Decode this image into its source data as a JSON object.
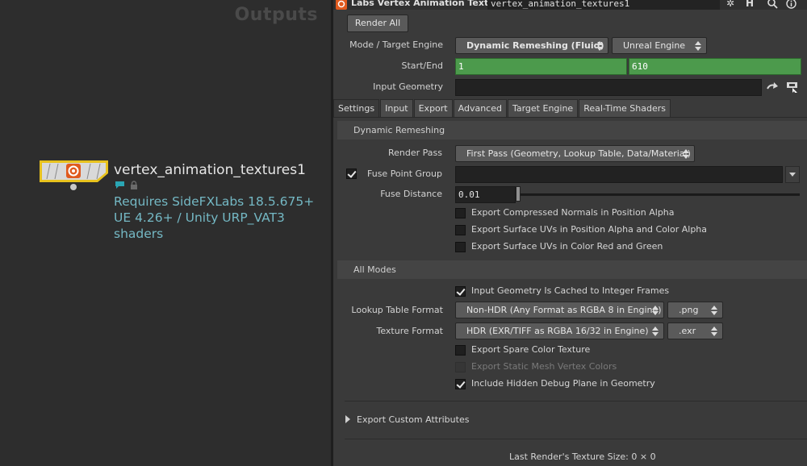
{
  "network": {
    "context_label": "Outputs",
    "node": {
      "name": "vertex_animation_textures1",
      "comment": "Requires SideFXLabs 18.5.675+ UE 4.26+ / Unity URP_VAT3 shaders",
      "color": "#e8c21e"
    }
  },
  "params": {
    "header": {
      "node_type": "Labs Vertex Animation Textures",
      "node_name": "vertex_animation_textures1",
      "icons": [
        "gear-icon",
        "help-icon",
        "search-icon",
        "info-icon"
      ]
    },
    "render_all_label": "Render All",
    "mode": {
      "label": "Mode / Target Engine",
      "value": "Dynamic Remeshing (Fluid)",
      "engine": "Unreal Engine"
    },
    "start_end": {
      "label": "Start/End",
      "start": "1",
      "end": "610"
    },
    "input_geometry": {
      "label": "Input Geometry",
      "value": ""
    },
    "tabs": [
      "Settings",
      "Input",
      "Export",
      "Advanced",
      "Target Engine",
      "Real-Time Shaders"
    ],
    "active_tab": "Settings",
    "dynamic": {
      "section": "Dynamic Remeshing",
      "render_pass_label": "Render Pass",
      "render_pass_value": "First Pass (Geometry, Lookup Table, Data/Material)",
      "fuse_group_label": "Fuse Point Group",
      "fuse_group_value": "",
      "fuse_distance_label": "Fuse Distance",
      "fuse_distance_value": "0.01",
      "checks": [
        {
          "label": "Export Compressed Normals in Position Alpha",
          "checked": false
        },
        {
          "label": "Export Surface UVs in Position Alpha and Color Alpha",
          "checked": false
        },
        {
          "label": "Export Surface UVs in Color Red and Green",
          "checked": false
        }
      ]
    },
    "all_modes": {
      "section": "All Modes",
      "cached_label": "Input Geometry Is Cached to Integer Frames",
      "lut_label": "Lookup Table Format",
      "lut_value": "Non-HDR (Any Format as RGBA 8 in Engine)",
      "lut_ext": ".png",
      "tex_label": "Texture Format",
      "tex_value": "HDR (EXR/TIFF as RGBA 16/32 in Engine)",
      "tex_ext": ".exr",
      "spare_label": "Export Spare Color Texture",
      "static_label": "Export Static Mesh Vertex Colors",
      "debug_label": "Include Hidden Debug Plane in Geometry"
    },
    "custom_attrs_label": "Export Custom Attributes",
    "last_render": "Last Render's Texture Size: 0 × 0"
  }
}
